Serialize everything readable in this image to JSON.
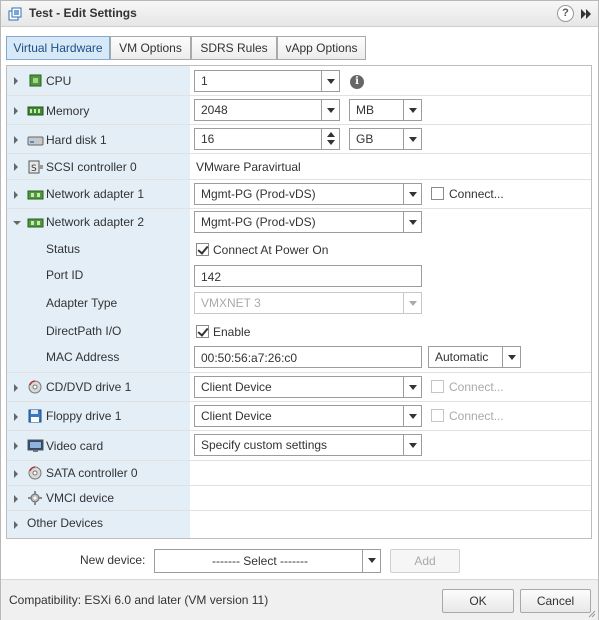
{
  "window": {
    "title": "Test - Edit Settings",
    "help_label": "?",
    "expand_icon": "fast-forward-icon"
  },
  "tabs": [
    "Virtual Hardware",
    "VM Options",
    "SDRS Rules",
    "vApp Options"
  ],
  "hardware": {
    "cpu": {
      "label": "CPU",
      "value": "1",
      "info": "i"
    },
    "memory": {
      "label": "Memory",
      "value": "2048",
      "unit": "MB"
    },
    "hard_disk": {
      "label": "Hard disk 1",
      "value": "16",
      "unit": "GB"
    },
    "scsi": {
      "label": "SCSI controller 0",
      "value": "VMware Paravirtual"
    },
    "net1": {
      "label": "Network adapter 1",
      "value": "Mgmt-PG (Prod-vDS)",
      "connect": "Connect..."
    },
    "net2": {
      "label": "Network adapter 2",
      "value": "Mgmt-PG (Prod-vDS)",
      "status_label": "Status",
      "status_value": "Connect At Power On",
      "port_label": "Port ID",
      "port_value": "142",
      "adapter_label": "Adapter Type",
      "adapter_value": "VMXNET 3",
      "directpath_label": "DirectPath I/O",
      "directpath_value": "Enable",
      "mac_label": "MAC Address",
      "mac_value": "00:50:56:a7:26:c0",
      "mac_mode": "Automatic"
    },
    "cddvd": {
      "label": "CD/DVD drive 1",
      "value": "Client Device",
      "connect": "Connect..."
    },
    "floppy": {
      "label": "Floppy drive 1",
      "value": "Client Device",
      "connect": "Connect..."
    },
    "video": {
      "label": "Video card",
      "value": "Specify custom settings"
    },
    "sata": {
      "label": "SATA controller 0"
    },
    "vmci": {
      "label": "VMCI device"
    },
    "other": {
      "label": "Other Devices"
    }
  },
  "new_device": {
    "label": "New device:",
    "select": "------- Select -------",
    "add": "Add"
  },
  "footer": {
    "compatibility": "Compatibility: ESXi 6.0 and later (VM version 11)",
    "ok": "OK",
    "cancel": "Cancel"
  },
  "colors": {
    "active_tab": "#d7e8f7",
    "left_column": "#e4eef7",
    "footer": "#f0f0f0"
  }
}
